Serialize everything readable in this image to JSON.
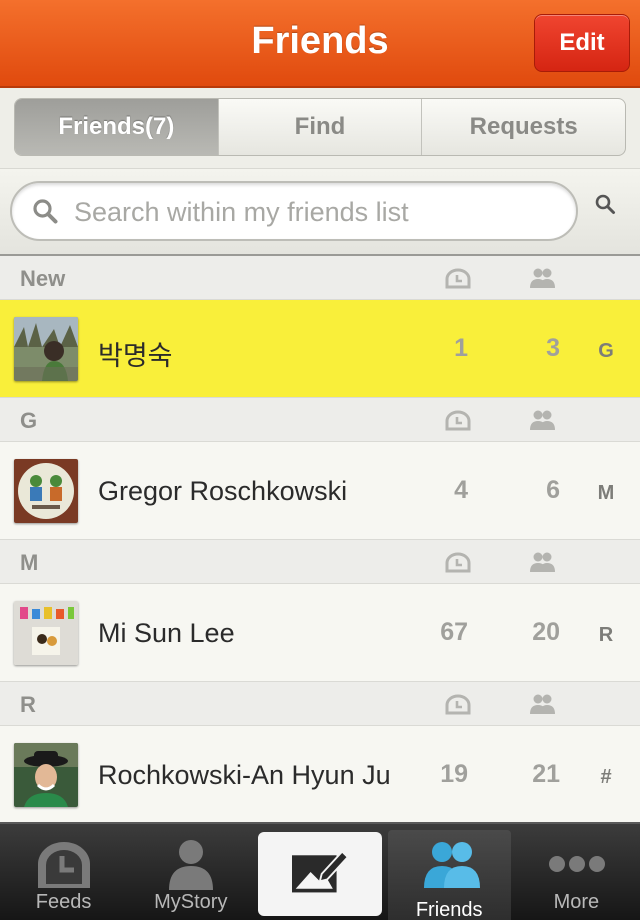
{
  "header": {
    "title": "Friends",
    "edit_label": "Edit"
  },
  "segments": [
    {
      "label": "Friends(7)",
      "active": true
    },
    {
      "label": "Find",
      "active": false
    },
    {
      "label": "Requests",
      "active": false
    }
  ],
  "search": {
    "placeholder": "Search within my friends list"
  },
  "sections": [
    {
      "label": "New",
      "rows": [
        {
          "name": "박명숙",
          "stat1": "1",
          "stat2": "3",
          "index": "G",
          "highlight": true,
          "avatar": "forest-photo"
        }
      ]
    },
    {
      "label": "G",
      "rows": [
        {
          "name": "Gregor Roschkowski",
          "stat1": "4",
          "stat2": "6",
          "index": "M",
          "highlight": false,
          "avatar": "kids-drawing"
        }
      ]
    },
    {
      "label": "M",
      "rows": [
        {
          "name": "Mi Sun Lee",
          "stat1": "67",
          "stat2": "20",
          "index": "R",
          "highlight": false,
          "avatar": "colorful-letters"
        }
      ]
    },
    {
      "label": "R",
      "rows": [
        {
          "name": "Rochkowski-An Hyun Ju",
          "stat1": "19",
          "stat2": "21",
          "index": "#",
          "highlight": false,
          "avatar": "woman-hat"
        }
      ]
    }
  ],
  "tabs": [
    {
      "label": "Feeds",
      "icon": "feeds-icon"
    },
    {
      "label": "MyStory",
      "icon": "person-icon"
    },
    {
      "label": "",
      "icon": "compose-icon"
    },
    {
      "label": "Friends",
      "icon": "friends-icon"
    },
    {
      "label": "More",
      "icon": "more-icon"
    }
  ],
  "colors": {
    "header": "#e85a1a",
    "edit": "#e0301a",
    "highlight": "#f9ef3a",
    "friends_tab_icon": "#3aa7d8"
  }
}
